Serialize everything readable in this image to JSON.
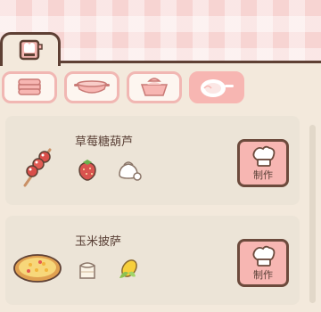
{
  "categories": [
    {
      "name": "cake-icon",
      "active": false
    },
    {
      "name": "bowl-icon",
      "active": false
    },
    {
      "name": "pot-icon",
      "active": false
    },
    {
      "name": "plate-icon",
      "active": true
    }
  ],
  "recipes": [
    {
      "title": "草莓糖葫芦",
      "dish_icon": "candied-strawberry-skewer-icon",
      "ingredients": [
        "strawberry-icon",
        "sugar-icon"
      ],
      "button_label": "制作"
    },
    {
      "title": "玉米披萨",
      "dish_icon": "corn-pizza-icon",
      "ingredients": [
        "flour-icon",
        "corn-icon"
      ],
      "button_label": "制作"
    }
  ]
}
